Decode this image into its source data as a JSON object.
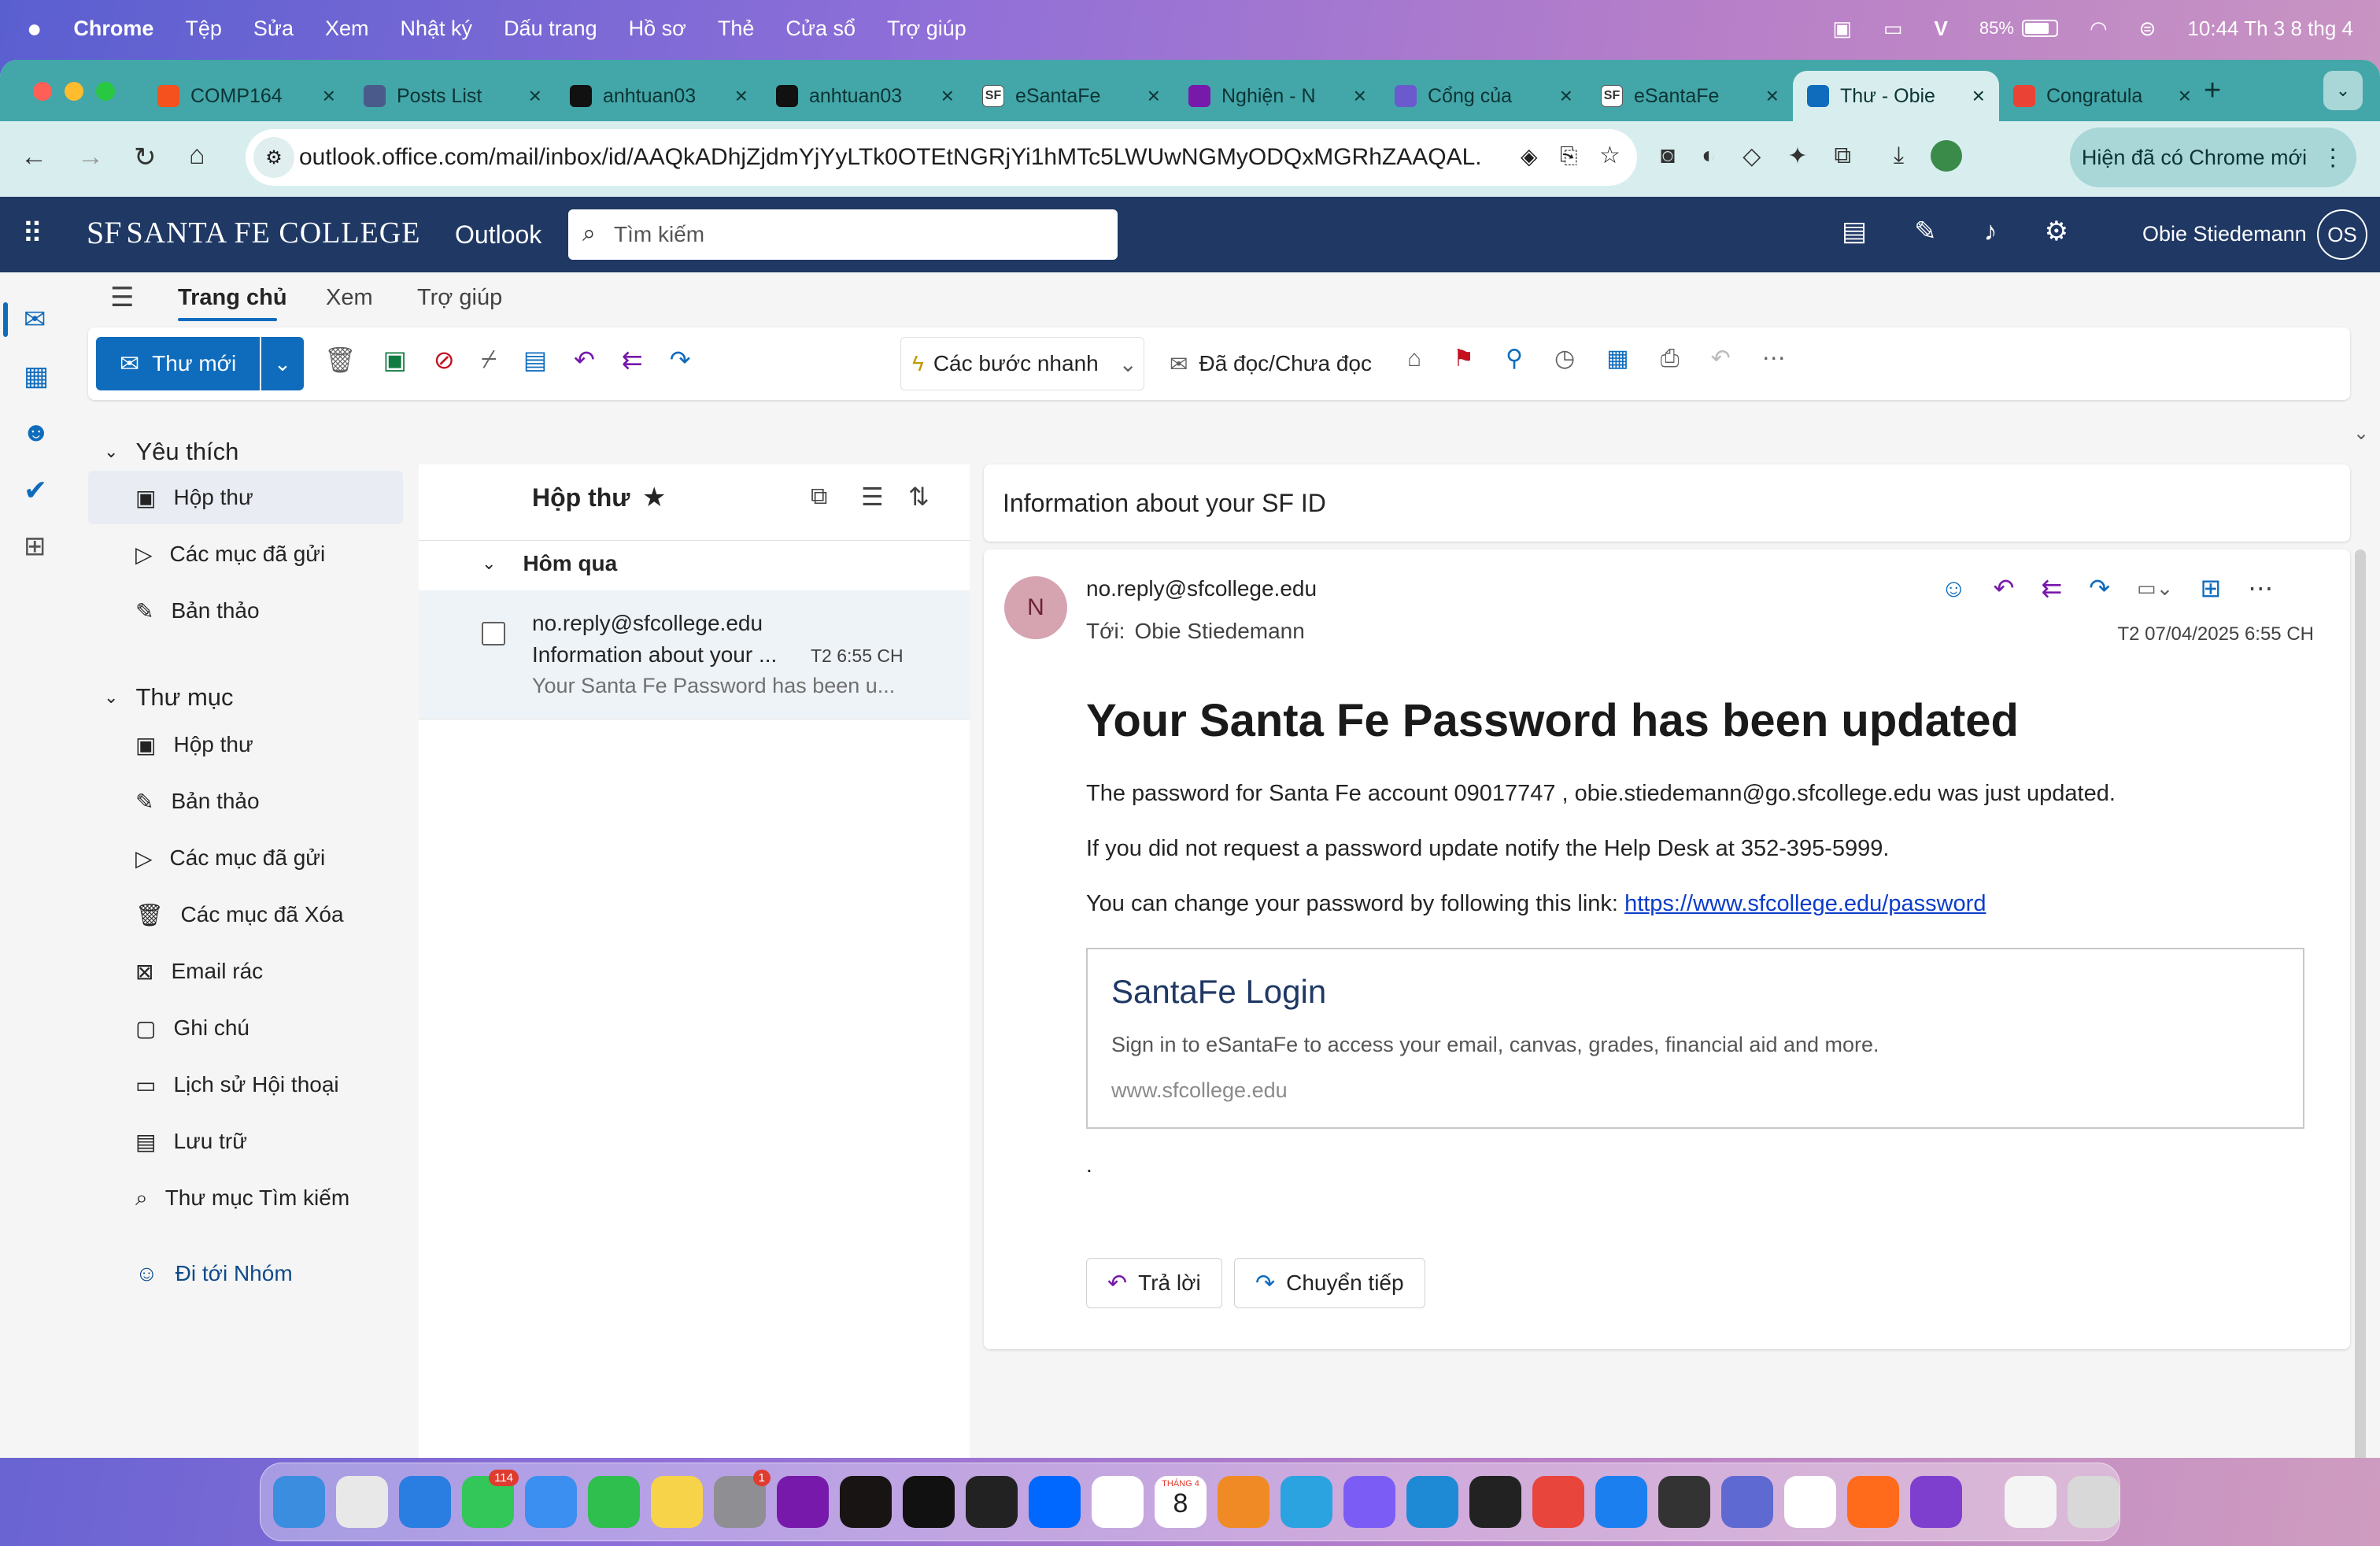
{
  "menubar": {
    "app": "Chrome",
    "items": [
      "Tệp",
      "Sửa",
      "Xem",
      "Nhật ký",
      "Dấu trang",
      "Hồ sơ",
      "Thẻ",
      "Cửa sổ",
      "Trợ giúp"
    ],
    "battery": "85%",
    "clock": "10:44 Th 3 8 thg 4"
  },
  "tabs": [
    {
      "title": "COMP164",
      "icon": "flame-icon",
      "color": "#f4511e"
    },
    {
      "title": "Posts List",
      "icon": "globe-icon",
      "color": "#4a5a8a"
    },
    {
      "title": "anhtuan03",
      "icon": "github-icon",
      "color": "#111111"
    },
    {
      "title": "anhtuan03",
      "icon": "github-icon",
      "color": "#111111"
    },
    {
      "title": "eSantaFe",
      "icon": "sf-icon",
      "color": "#ffffff"
    },
    {
      "title": "Nghiện - N",
      "icon": "onenote-icon",
      "color": "#7719aa"
    },
    {
      "title": "Cổng của",
      "icon": "feather-icon",
      "color": "#6a5acd"
    },
    {
      "title": "eSantaFe",
      "icon": "sf-icon",
      "color": "#ffffff"
    },
    {
      "title": "Thư - Obie",
      "icon": "outlook-icon",
      "color": "#0f6cbd"
    },
    {
      "title": "Congratula",
      "icon": "gmail-icon",
      "color": "#ea4335"
    }
  ],
  "address": "outlook.office.com/mail/inbox/id/AAQkADhjZjdmYjYyLTk0OTEtNGRjYi1hMTc5LWUwNGMyODQxMGRhZAAQAL...",
  "chrome_update": "Hiện đã có Chrome mới",
  "header": {
    "logo": "SANTA FE COLLEGE",
    "logo_mark": "SF",
    "app_name": "Outlook",
    "search_placeholder": "Tìm kiếm",
    "user": "Obie Stiedemann",
    "initials": "OS"
  },
  "ribbon_tabs": [
    "Trang chủ",
    "Xem",
    "Trợ giúp"
  ],
  "ribbon": {
    "new_mail": "Thư mới",
    "quick_steps": "Các bước nhanh",
    "read_unread": "Đã đọc/Chưa đọc"
  },
  "nav": {
    "favorites_header": "Yêu thích",
    "favorites": [
      "Hộp thư",
      "Các mục đã gửi",
      "Bản thảo"
    ],
    "folders_header": "Thư mục",
    "folders": [
      "Hộp thư",
      "Bản thảo",
      "Các mục đã gửi",
      "Các mục đã Xóa",
      "Email rác",
      "Ghi chú",
      "Lịch sử Hội thoại",
      "Lưu trữ",
      "Thư mục Tìm kiếm"
    ],
    "groups": "Đi tới Nhóm"
  },
  "list": {
    "title": "Hộp thư",
    "group": "Hôm qua",
    "item": {
      "sender": "no.reply@sfcollege.edu",
      "subject": "Information about your ...",
      "time": "T2 6:55 CH",
      "preview": "Your Santa Fe Password has been u..."
    }
  },
  "message": {
    "subject": "Information about your SF ID",
    "avatar": "N",
    "from": "no.reply@sfcollege.edu",
    "to_label": "Tới:",
    "to": "Obie Stiedemann",
    "date": "T2 07/04/2025 6:55 CH",
    "heading": "Your Santa Fe Password has been updated",
    "p1": "The password for Santa Fe account 09017747 , obie.stiedemann@go.sfcollege.edu was just updated.",
    "p2": "If you did not request a password update notify the Help Desk at 352-395-5999.",
    "p3": "You can change your password by following this link: ",
    "link": "https://www.sfcollege.edu/password",
    "card_title": "SantaFe Login",
    "card_desc": "Sign in to eSantaFe to access your email, canvas, grades, financial aid and more.",
    "card_url": "www.sfcollege.edu",
    "dot": ".",
    "reply": "Trả lời",
    "forward": "Chuyển tiếp"
  },
  "dock": {
    "messages_badge": "114",
    "settings_badge": "1",
    "calendar_month": "THÁNG 4",
    "calendar_day": "8",
    "apps": [
      "finder-icon",
      "launchpad-icon",
      "safari-icon",
      "messages-icon",
      "mail-icon",
      "facetime-icon",
      "notes-icon",
      "settings-icon",
      "onenote-icon",
      "spotify-icon",
      "pycharm-icon",
      "terminal-icon",
      "zalo-icon",
      "bluesky-icon",
      "calendar-icon",
      "pages-icon",
      "telegram-icon",
      "messenger-icon",
      "vscode-icon",
      "cursor-icon",
      "chrome-icon",
      "xcode-icon",
      "mirror-icon",
      "linear-icon",
      "mongodb-icon",
      "firefox-icon",
      "github-desktop-icon",
      "preview-icon",
      "trash-icon"
    ]
  }
}
